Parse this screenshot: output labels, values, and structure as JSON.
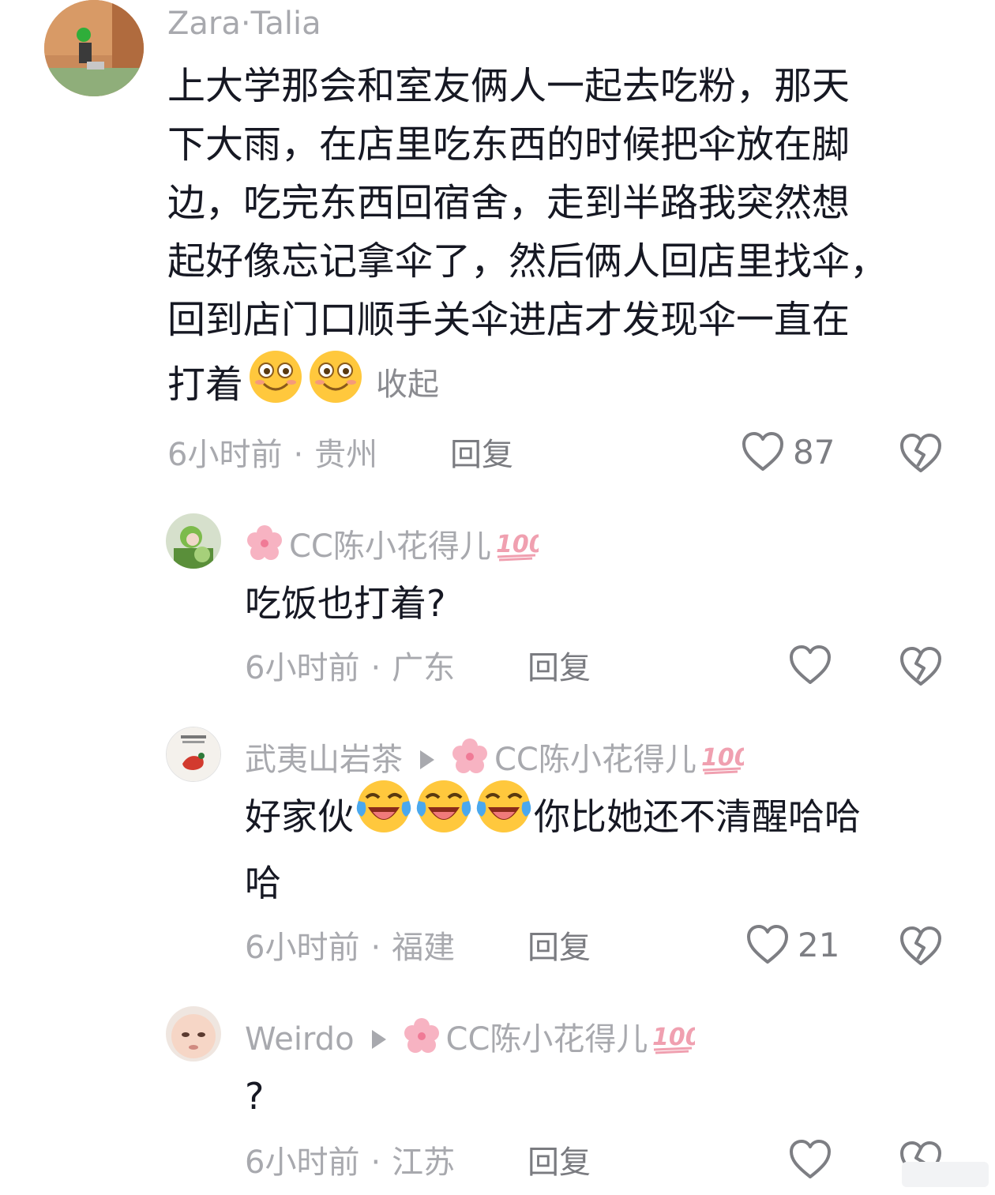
{
  "comments": [
    {
      "username": "Zara·Talia",
      "text_lines": [
        "上大学那会和室友俩人一起去吃粉，那天",
        "下大雨，在店里吃东西的时候把伞放在脚",
        "边，吃完东西回宿舍，走到半路我突然想",
        "起好像忘记拿伞了，然后俩人回店里找伞，",
        "回到店门口顺手关伞进店才发现伞一直在",
        "打着"
      ],
      "collapse_label": "收起",
      "time": "6小时前",
      "location": "贵州",
      "reply_label": "回复",
      "likes": "87"
    }
  ],
  "replies": [
    {
      "username": "CC陈小花得儿",
      "text": "吃饭也打着?",
      "time": "6小时前",
      "location": "广东",
      "reply_label": "回复",
      "likes": ""
    },
    {
      "username": "武夷山岩茶",
      "reply_to": "CC陈小花得儿",
      "text_before": "好家伙",
      "text_after": "你比她还不清醒哈哈",
      "text_line2": "哈",
      "time": "6小时前",
      "location": "福建",
      "reply_label": "回复",
      "likes": "21"
    },
    {
      "username": "Weirdo",
      "reply_to": "CC陈小花得儿",
      "text": "?",
      "time": "6小时前",
      "location": "江苏",
      "reply_label": "回复",
      "likes": ""
    }
  ],
  "meta_separator": "·",
  "icons": {
    "like": "heart-outline-icon",
    "dislike": "broken-heart-icon",
    "flower": "cherry-blossom-icon",
    "hundred": "hundred-points-icon",
    "smile": "smiling-face-emoji",
    "laugh": "laughing-crying-emoji",
    "reply_arrow": "reply-to-arrow-icon"
  },
  "colors": {
    "username": "#a8a9ae",
    "text": "#161823",
    "meta": "#a8a9ae",
    "icon": "#7d7e83",
    "flower": "#f7b3c2",
    "hundred": "#f0a0b0"
  }
}
